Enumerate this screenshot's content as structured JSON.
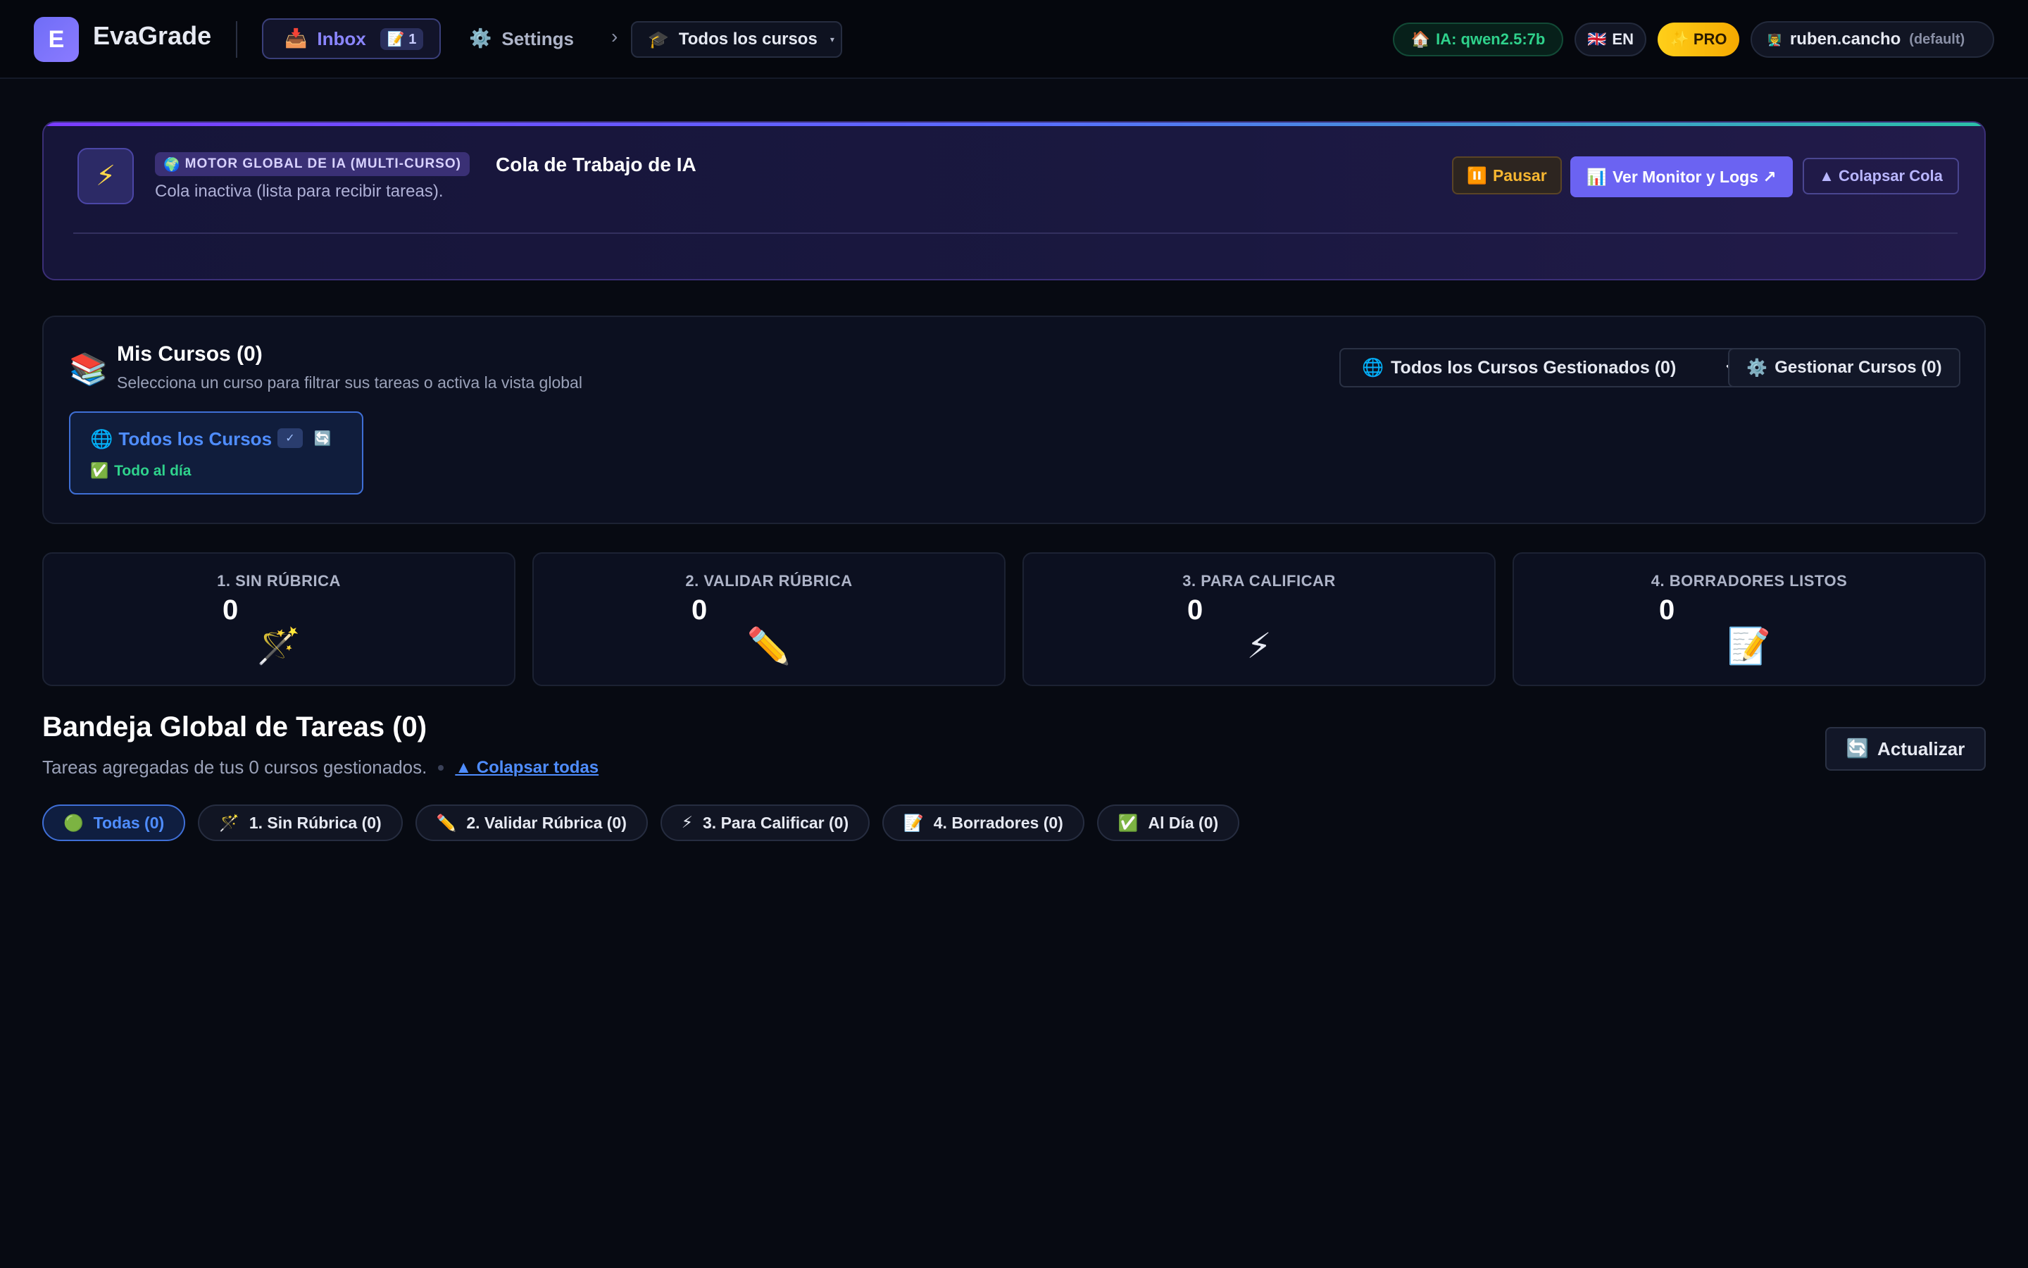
{
  "app": {
    "logo_letter": "E",
    "name": "EvaGrade"
  },
  "nav": {
    "inbox": {
      "icon": "📥",
      "label": "Inbox",
      "badge_icon": "📝",
      "badge_count": "1"
    },
    "settings": {
      "icon": "⚙️",
      "label": "Settings"
    },
    "breadcrumb_sep": "›",
    "course_selector": {
      "icon": "🎓",
      "label": "Todos los cursos",
      "caret": "▾"
    }
  },
  "status": {
    "ia": {
      "icon": "🏠",
      "label": "IA: qwen2.5:7b"
    },
    "lang": {
      "icon": "🇬🇧",
      "label": "EN"
    },
    "pro": {
      "icon": "✨",
      "label": "PRO"
    },
    "user": {
      "icon": "👨‍🏫",
      "name": "ruben.cancho",
      "tag": "(default)"
    }
  },
  "queue": {
    "icon": "⚡",
    "tag_icon": "🌍",
    "tag": "MOTOR GLOBAL DE IA (MULTI-CURSO)",
    "title": "Cola de Trabajo de IA",
    "subtitle": "Cola inactiva (lista para recibir tareas).",
    "pause_icon": "⏸️",
    "pause_label": "Pausar",
    "monitor_icon": "📊",
    "monitor_label": "Ver Monitor y Logs ↗",
    "collapse_label": "▲ Colapsar Cola"
  },
  "courses": {
    "icon": "📚",
    "title": "Mis Cursos (0)",
    "subtitle": "Selecciona un curso para filtrar sus tareas o activa la vista global",
    "select_icon": "🌐",
    "select_label": "Todos los Cursos Gestionados (0)",
    "manage_icon": "⚙️",
    "manage_label": "Gestionar Cursos (0)",
    "card": {
      "icon": "🌐",
      "title": "Todos los Cursos",
      "check": "✓",
      "refresh": "🔄",
      "status_icon": "✅",
      "status": "Todo al día"
    }
  },
  "stages": [
    {
      "label": "1. SIN RÚBRICA",
      "count": "0",
      "icon": "🪄"
    },
    {
      "label": "2. VALIDAR RÚBRICA",
      "count": "0",
      "icon": "✏️"
    },
    {
      "label": "3. PARA CALIFICAR",
      "count": "0",
      "icon": "⚡"
    },
    {
      "label": "4. BORRADORES LISTOS",
      "count": "0",
      "icon": "📝"
    }
  ],
  "inbox": {
    "title": "Bandeja Global de Tareas (0)",
    "subtitle": "Tareas agregadas de tus 0 cursos gestionados.",
    "collapse_all": "▲ Colapsar todas",
    "refresh_icon": "🔄",
    "refresh_label": "Actualizar",
    "filters": [
      {
        "icon": "🟢",
        "label": "Todas (0)"
      },
      {
        "icon": "🪄",
        "label": "1. Sin Rúbrica (0)"
      },
      {
        "icon": "✏️",
        "label": "2. Validar Rúbrica (0)"
      },
      {
        "icon": "⚡",
        "label": "3. Para Calificar (0)"
      },
      {
        "icon": "📝",
        "label": "4. Borradores (0)"
      },
      {
        "icon": "✅",
        "label": "Al Día (0)"
      }
    ]
  },
  "colors": {
    "background": "#070a12",
    "accent": "#6b63f2",
    "link": "#4f8dff",
    "success": "#2fd28c",
    "pro": "#ffcf1a"
  }
}
